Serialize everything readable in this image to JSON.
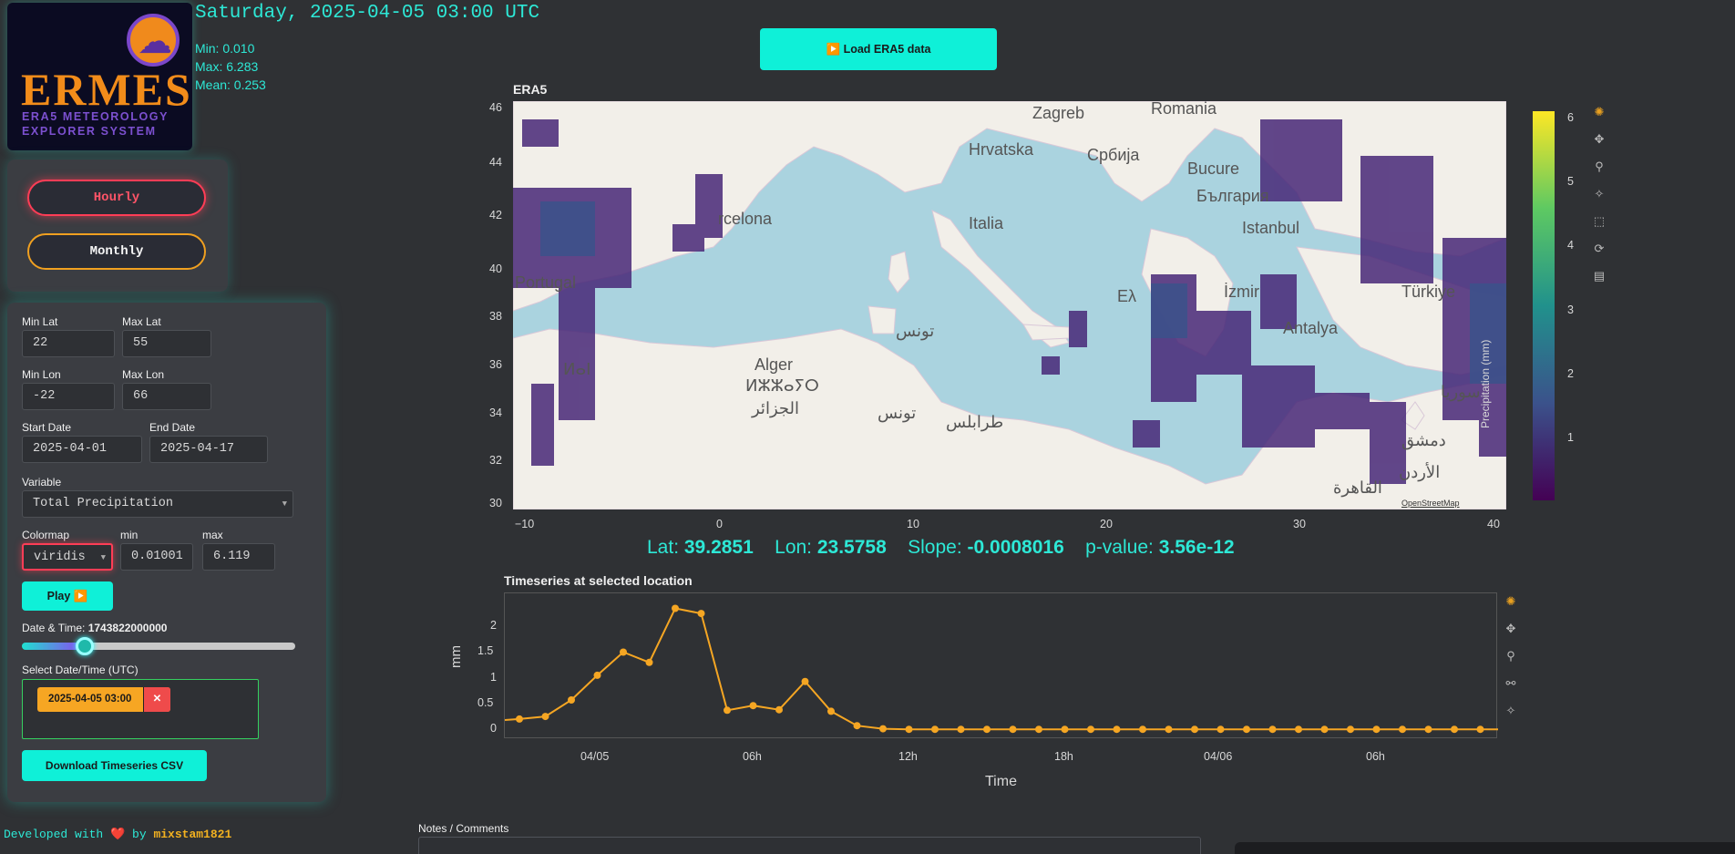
{
  "logo": {
    "title": "ERMES",
    "subtitle_line1": "ERA5 METEOROLOGY",
    "subtitle_line2": "EXPLORER SYSTEM"
  },
  "header": {
    "datetime": "Saturday, 2025-04-05 03:00 UTC",
    "min": "Min: 0.010",
    "max": "Max: 6.283",
    "mean": "Mean: 0.253"
  },
  "load_button": "▶️ Load ERA5 data",
  "modes": {
    "hourly": "Hourly",
    "monthly": "Monthly"
  },
  "controls": {
    "min_lat_label": "Min Lat",
    "min_lat": "22",
    "max_lat_label": "Max Lat",
    "max_lat": "55",
    "min_lon_label": "Min Lon",
    "min_lon": "-22",
    "max_lon_label": "Max Lon",
    "max_lon": "66",
    "start_date_label": "Start Date",
    "start_date": "2025-04-01",
    "end_date_label": "End Date",
    "end_date": "2025-04-17",
    "variable_label": "Variable",
    "variable": "Total Precipitation",
    "colormap_label": "Colormap",
    "colormap": "viridis",
    "min_label": "min",
    "min": "0.01001",
    "max_label": "max",
    "max": "6.119",
    "play": "Play ▶️",
    "datetime_label": "Date & Time:",
    "datetime_value": "1743822000000",
    "slider_fraction": 0.23,
    "select_label": "Select Date/Time (UTC)",
    "chip": "2025-04-05 03:00",
    "chip_remove": "✕",
    "download": "Download Timeseries CSV"
  },
  "footer": {
    "prefix": "Developed with",
    "heart": "❤️",
    "by": "by",
    "author": "mixstam1821"
  },
  "map": {
    "title": "ERA5",
    "y_ticks": [
      "46",
      "44",
      "42",
      "40",
      "38",
      "36",
      "34",
      "32",
      "30"
    ],
    "x_ticks": [
      "−10",
      "0",
      "10",
      "20",
      "30",
      "40"
    ],
    "attribution": "OpenStreetMap",
    "places": [
      "Zagreb",
      "Romania",
      "Hrvatska",
      "Србија",
      "Bucure",
      "България",
      "Italia",
      "Istanbul",
      "rcelona",
      "Portugal",
      "Ελ",
      "İzmir",
      "Türkiye",
      "Antalya",
      "تونس",
      "Alger",
      "ⵍⵣⵣⴰⵢⵔ",
      "الجزائر",
      "تونس",
      "طرابلس",
      "سوريا",
      "دمشق",
      "الأردن",
      "القاهرة",
      "ⵍⴰⵏ"
    ],
    "colorbar_ticks": [
      "6",
      "5",
      "4",
      "3",
      "2",
      "1"
    ],
    "colorbar_label": "Precipitation (mm)",
    "colors": {
      "sea": "#aad3df",
      "land": "#f2efe9",
      "precip": "#482878"
    }
  },
  "location": {
    "lat_label": "Lat:",
    "lat": "39.2851",
    "lon_label": "Lon:",
    "lon": "23.5758",
    "slope_label": "Slope:",
    "slope": "-0.0008016",
    "pvalue_label": "p-value:",
    "pvalue": "3.56e-12"
  },
  "chart_data": {
    "type": "line",
    "title": "Timeseries at selected location",
    "xlabel": "Time",
    "ylabel": "mm",
    "x_ticks": [
      "04/05",
      "06h",
      "12h",
      "18h",
      "04/06",
      "06h"
    ],
    "y_ticks": [
      "0",
      "0.5",
      "1",
      "1.5",
      "2"
    ],
    "ylim": [
      -0.05,
      2.5
    ],
    "series": [
      {
        "color": "#f5a623",
        "values": [
          0.2,
          0.25,
          0.57,
          1.05,
          1.5,
          1.3,
          2.35,
          2.25,
          0.37,
          0.46,
          0.38,
          0.93,
          0.35,
          0.07,
          0.01,
          0,
          0,
          0,
          0,
          0,
          0,
          0,
          0,
          0,
          0,
          0,
          0,
          0,
          0,
          0,
          0,
          0,
          0,
          0,
          0,
          0,
          0,
          0,
          0,
          0
        ]
      }
    ]
  },
  "notes_label": "Notes / Comments"
}
